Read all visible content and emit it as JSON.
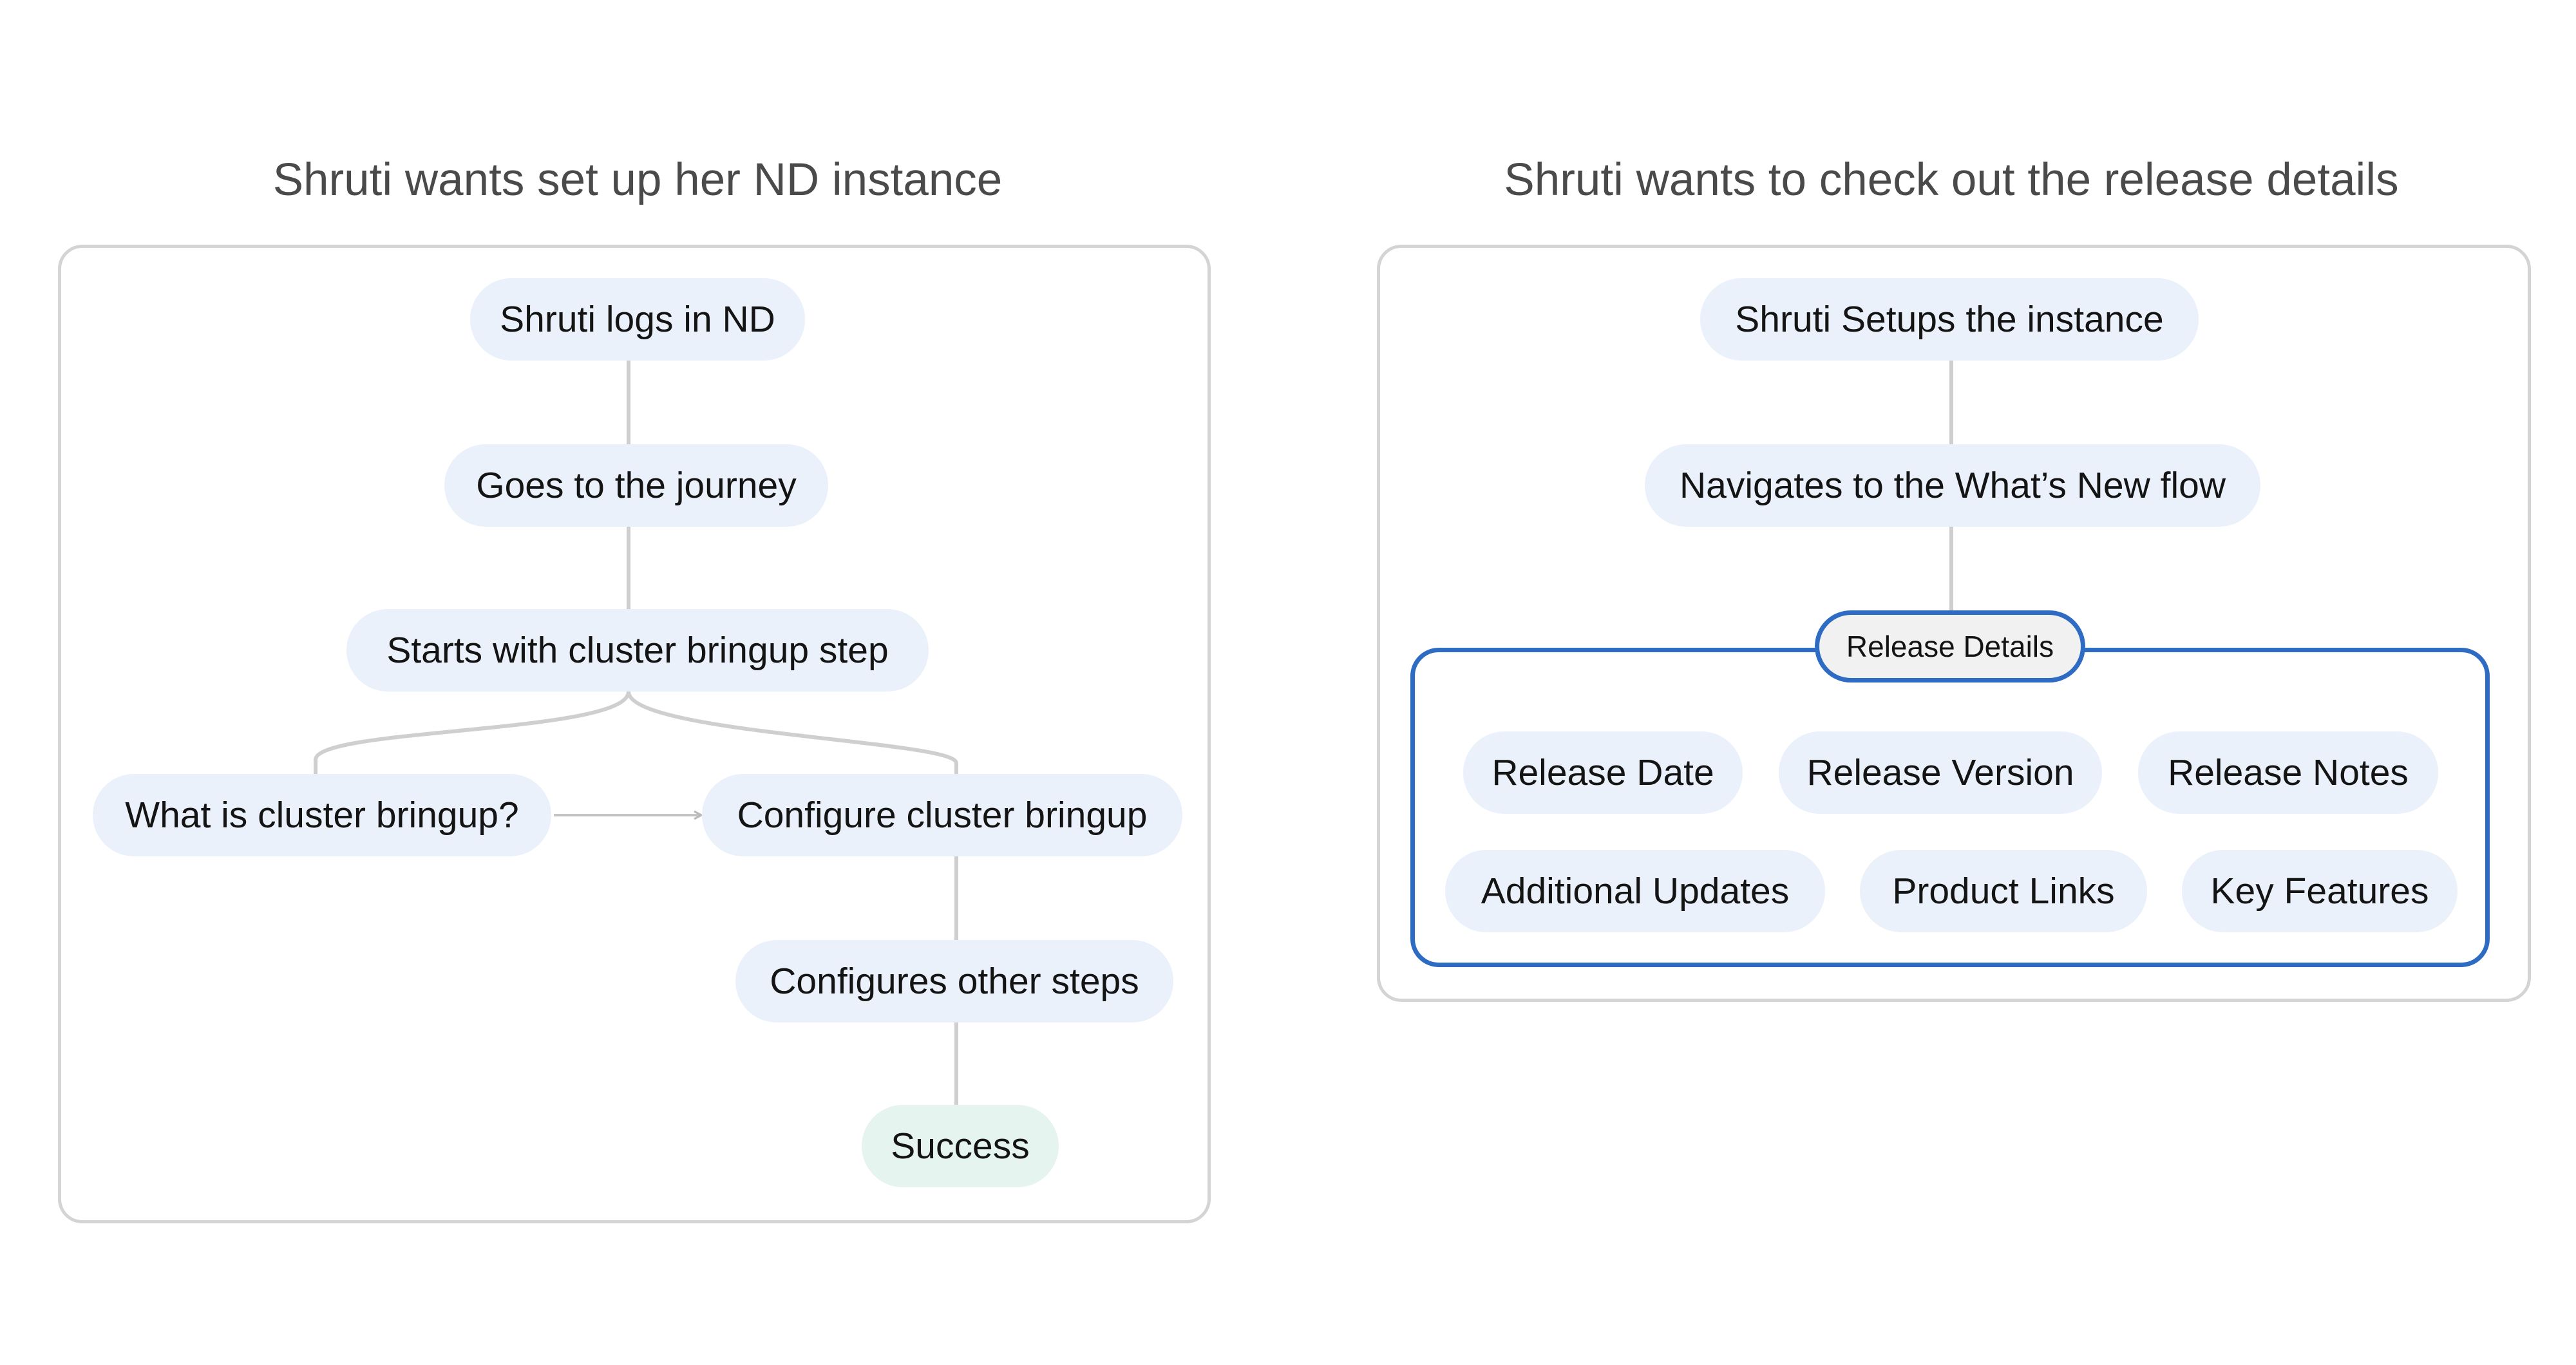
{
  "left_panel": {
    "title": "Shruti wants set up her ND instance",
    "steps": {
      "login": "Shruti logs in ND",
      "journey": "Goes to the journey",
      "start": "Starts with cluster bringup step",
      "what_is": "What is cluster bringup?",
      "configure": "Configure cluster bringup",
      "other_steps": "Configures other steps",
      "success": "Success"
    }
  },
  "right_panel": {
    "title": "Shruti wants to check out the release details",
    "steps": {
      "setup": "Shruti Setups the instance",
      "navigate": "Navigates to the What’s New flow"
    },
    "group": {
      "label": "Release Details",
      "items": [
        "Release Date",
        "Release Version",
        "Release Notes",
        "Additional Updates",
        "Product Links",
        "Key Features"
      ]
    }
  },
  "colors": {
    "pill_fill": "#eaf1fa",
    "success_fill": "#e6f4f0",
    "group_border": "#2e6cc4",
    "frame_border": "#d4d4d4",
    "connector": "#cfcfcf"
  }
}
